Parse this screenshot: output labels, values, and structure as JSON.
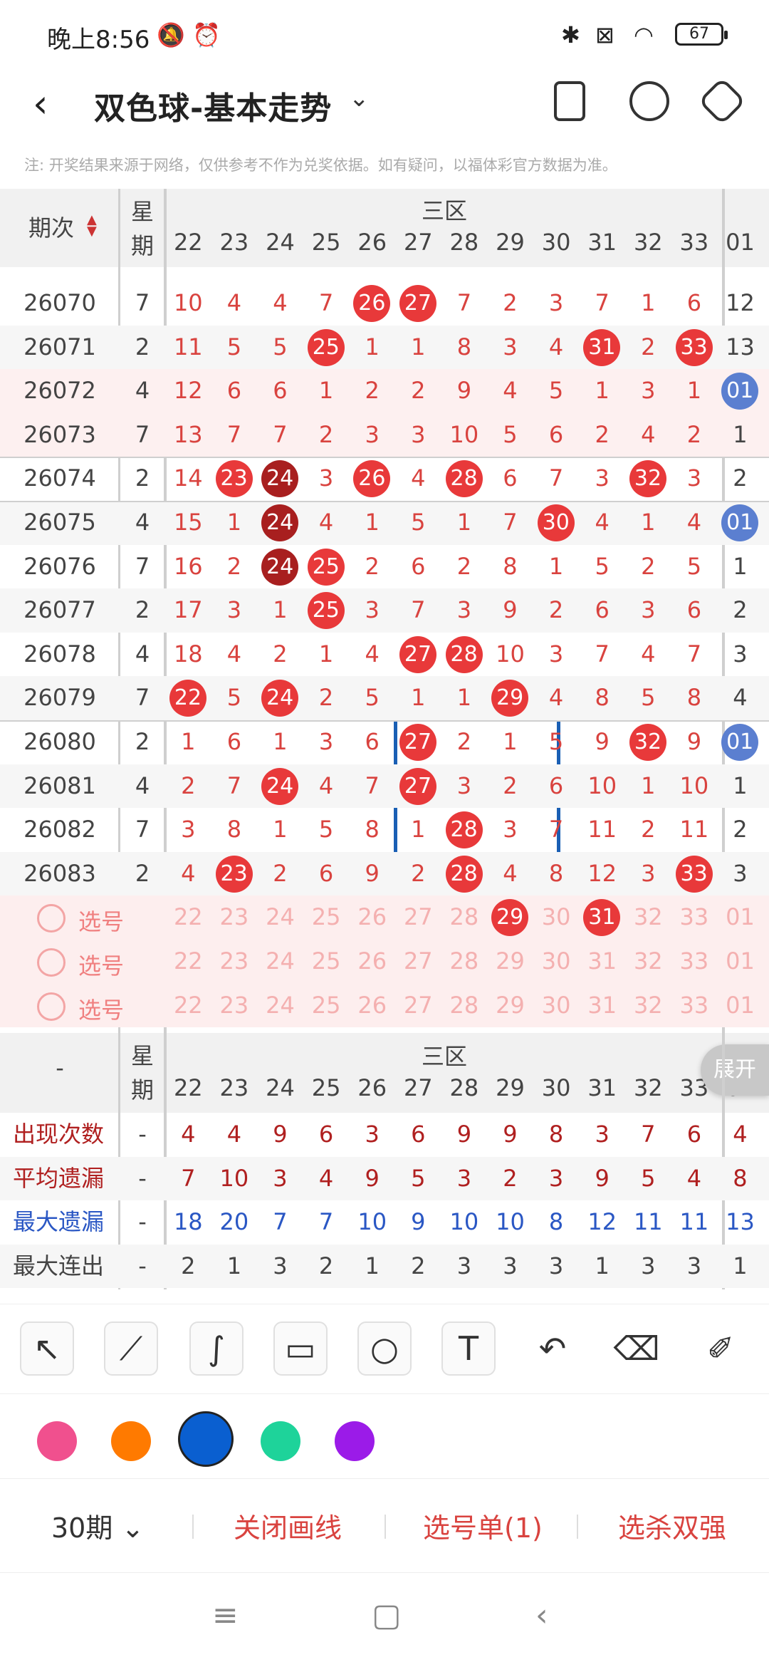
{
  "status": {
    "time": "晚上8:56",
    "battery": "67"
  },
  "header": {
    "title": "双色球-基本走势"
  },
  "notice": "注: 开奖结果来源于网络，仅供参考不作为兑奖依据。如有疑问，以福体彩官方数据为准。",
  "table": {
    "period_label": "期次",
    "weekday_label_1": "星",
    "weekday_label_2": "期",
    "section_label": "三区",
    "columns": [
      "22",
      "23",
      "24",
      "25",
      "26",
      "27",
      "28",
      "29",
      "30",
      "31",
      "32",
      "33",
      "01"
    ],
    "rows": [
      {
        "id": "26070",
        "wk": "7",
        "cells": [
          "10",
          "4",
          "4",
          "7",
          "26",
          "27",
          "7",
          "2",
          "3",
          "7",
          "1",
          "6",
          "12"
        ],
        "balls": [
          4,
          5
        ],
        "dark": []
      },
      {
        "id": "26071",
        "wk": "2",
        "cells": [
          "11",
          "5",
          "5",
          "25",
          "1",
          "1",
          "8",
          "3",
          "4",
          "31",
          "2",
          "33",
          "13"
        ],
        "balls": [
          3,
          9,
          11
        ],
        "dark": []
      },
      {
        "id": "26072",
        "wk": "4",
        "cells": [
          "12",
          "6",
          "6",
          "1",
          "2",
          "2",
          "9",
          "4",
          "5",
          "1",
          "3",
          "1",
          "01"
        ],
        "balls": [],
        "dark": [],
        "blue": [
          12
        ]
      },
      {
        "id": "26073",
        "wk": "7",
        "cells": [
          "13",
          "7",
          "7",
          "2",
          "3",
          "3",
          "10",
          "5",
          "6",
          "2",
          "4",
          "2",
          "1"
        ],
        "balls": [],
        "dark": []
      },
      {
        "id": "26074",
        "wk": "2",
        "cells": [
          "14",
          "23",
          "24",
          "3",
          "26",
          "4",
          "28",
          "6",
          "7",
          "3",
          "32",
          "3",
          "2"
        ],
        "balls": [
          1,
          4,
          6,
          10
        ],
        "dark": [
          2
        ]
      },
      {
        "id": "26075",
        "wk": "4",
        "cells": [
          "15",
          "1",
          "24",
          "4",
          "1",
          "5",
          "1",
          "7",
          "30",
          "4",
          "1",
          "4",
          "01"
        ],
        "balls": [
          8
        ],
        "dark": [
          2
        ],
        "blue": [
          12
        ]
      },
      {
        "id": "26076",
        "wk": "7",
        "cells": [
          "16",
          "2",
          "24",
          "25",
          "2",
          "6",
          "2",
          "8",
          "1",
          "5",
          "2",
          "5",
          "1"
        ],
        "balls": [
          3
        ],
        "dark": [
          2
        ]
      },
      {
        "id": "26077",
        "wk": "2",
        "cells": [
          "17",
          "3",
          "1",
          "25",
          "3",
          "7",
          "3",
          "9",
          "2",
          "6",
          "3",
          "6",
          "2"
        ],
        "balls": [
          3
        ],
        "dark": []
      },
      {
        "id": "26078",
        "wk": "4",
        "cells": [
          "18",
          "4",
          "2",
          "1",
          "4",
          "27",
          "28",
          "10",
          "3",
          "7",
          "4",
          "7",
          "3"
        ],
        "balls": [
          5,
          6
        ],
        "dark": []
      },
      {
        "id": "26079",
        "wk": "7",
        "cells": [
          "22",
          "5",
          "24",
          "2",
          "5",
          "1",
          "1",
          "29",
          "4",
          "8",
          "5",
          "8",
          "4"
        ],
        "balls": [
          0,
          2,
          7
        ],
        "dark": []
      },
      {
        "id": "26080",
        "wk": "2",
        "cells": [
          "1",
          "6",
          "1",
          "3",
          "6",
          "27",
          "2",
          "1",
          "5",
          "9",
          "32",
          "9",
          "01"
        ],
        "balls": [
          5,
          10
        ],
        "dark": [],
        "blue": [
          12
        ]
      },
      {
        "id": "26081",
        "wk": "4",
        "cells": [
          "2",
          "7",
          "24",
          "4",
          "7",
          "27",
          "3",
          "2",
          "6",
          "10",
          "1",
          "10",
          "1"
        ],
        "balls": [
          2,
          5
        ],
        "dark": []
      },
      {
        "id": "26082",
        "wk": "7",
        "cells": [
          "3",
          "8",
          "1",
          "5",
          "8",
          "1",
          "28",
          "3",
          "7",
          "11",
          "2",
          "11",
          "2"
        ],
        "balls": [
          6
        ],
        "dark": []
      },
      {
        "id": "26083",
        "wk": "2",
        "cells": [
          "4",
          "23",
          "2",
          "6",
          "9",
          "2",
          "28",
          "4",
          "8",
          "12",
          "3",
          "33",
          "3"
        ],
        "balls": [
          1,
          6,
          11
        ],
        "dark": []
      }
    ],
    "pick_label": "选号",
    "pick_rows": [
      {
        "cells": [
          "22",
          "23",
          "24",
          "25",
          "26",
          "27",
          "28",
          "29",
          "30",
          "31",
          "32",
          "33",
          "01"
        ],
        "balls": [
          7,
          9
        ]
      },
      {
        "cells": [
          "22",
          "23",
          "24",
          "25",
          "26",
          "27",
          "28",
          "29",
          "30",
          "31",
          "32",
          "33",
          "01"
        ],
        "balls": []
      },
      {
        "cells": [
          "22",
          "23",
          "24",
          "25",
          "26",
          "27",
          "28",
          "29",
          "30",
          "31",
          "32",
          "33",
          "01"
        ],
        "balls": []
      }
    ]
  },
  "stats": {
    "dash": "-",
    "expand_label": "展开",
    "rows": [
      {
        "name": "出现次数",
        "wk": "-",
        "color": "#b02020",
        "values": [
          "4",
          "4",
          "9",
          "6",
          "3",
          "6",
          "9",
          "9",
          "8",
          "3",
          "7",
          "6",
          "4"
        ]
      },
      {
        "name": "平均遗漏",
        "wk": "-",
        "color": "#b02020",
        "values": [
          "7",
          "10",
          "3",
          "4",
          "9",
          "5",
          "3",
          "2",
          "3",
          "9",
          "5",
          "4",
          "8"
        ]
      },
      {
        "name": "最大遗漏",
        "wk": "-",
        "color": "#2a57c4",
        "values": [
          "18",
          "20",
          "7",
          "7",
          "10",
          "9",
          "10",
          "10",
          "8",
          "12",
          "11",
          "11",
          "13"
        ]
      },
      {
        "name": "最大连出",
        "wk": "-",
        "color": "#444444",
        "values": [
          "2",
          "1",
          "3",
          "2",
          "1",
          "2",
          "3",
          "3",
          "3",
          "1",
          "3",
          "3",
          "1"
        ]
      }
    ]
  },
  "tools": [
    "arrow-tool",
    "line-tool",
    "curve-tool",
    "rect-tool",
    "circle-tool",
    "text-tool",
    "undo-tool",
    "eraser-tool",
    "clear-tool"
  ],
  "palette": [
    "#f0508e",
    "#ff7a00",
    "#0a5fd0",
    "#1ed39a",
    "#9b1be8"
  ],
  "bottom": {
    "periods": "30期",
    "close_draw": "关闭画线",
    "pick_list": "选号单(1)",
    "select_kill": "选杀双强"
  }
}
